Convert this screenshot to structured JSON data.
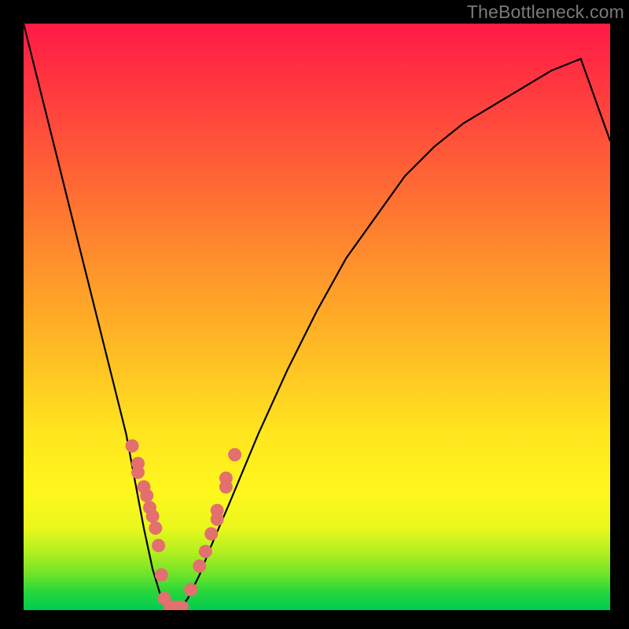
{
  "watermark": "TheBottleneck.com",
  "chart_data": {
    "type": "line",
    "title": "",
    "xlabel": "",
    "ylabel": "",
    "xlim": [
      0,
      1
    ],
    "ylim": [
      0,
      1
    ],
    "series": [
      {
        "name": "curve",
        "x": [
          0.0,
          0.03,
          0.06,
          0.09,
          0.12,
          0.15,
          0.175,
          0.19,
          0.205,
          0.22,
          0.235,
          0.25,
          0.265,
          0.28,
          0.3,
          0.32,
          0.35,
          0.4,
          0.45,
          0.5,
          0.55,
          0.6,
          0.65,
          0.7,
          0.75,
          0.8,
          0.85,
          0.9,
          0.95,
          1.0
        ],
        "y": [
          1.0,
          0.88,
          0.76,
          0.64,
          0.52,
          0.4,
          0.3,
          0.22,
          0.14,
          0.07,
          0.02,
          0.0,
          0.0,
          0.02,
          0.06,
          0.11,
          0.18,
          0.3,
          0.41,
          0.51,
          0.6,
          0.67,
          0.74,
          0.79,
          0.83,
          0.86,
          0.89,
          0.92,
          0.94,
          0.8
        ]
      },
      {
        "name": "dots",
        "x": [
          0.185,
          0.195,
          0.195,
          0.205,
          0.21,
          0.215,
          0.22,
          0.225,
          0.23,
          0.235,
          0.24,
          0.25,
          0.26,
          0.27,
          0.285,
          0.3,
          0.31,
          0.32,
          0.33,
          0.33,
          0.345,
          0.345,
          0.36
        ],
        "y": [
          0.28,
          0.25,
          0.235,
          0.21,
          0.195,
          0.175,
          0.16,
          0.14,
          0.11,
          0.06,
          0.02,
          0.005,
          0.005,
          0.005,
          0.035,
          0.075,
          0.1,
          0.13,
          0.155,
          0.17,
          0.21,
          0.225,
          0.265
        ]
      }
    ],
    "dot_color": "#e36f6f",
    "curve_color": "#000000"
  }
}
